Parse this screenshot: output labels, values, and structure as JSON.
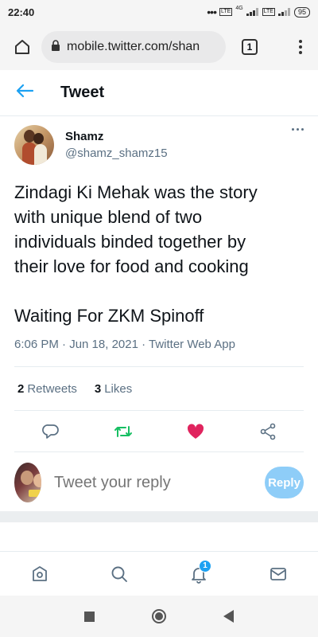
{
  "status_bar": {
    "time": "22:40",
    "network_label": "4G",
    "lte_label": "LTE",
    "battery": "95"
  },
  "browser": {
    "url": "mobile.twitter.com/shan",
    "tab_count": "1"
  },
  "page": {
    "title": "Tweet"
  },
  "tweet": {
    "display_name": "Shamz",
    "handle": "@shamz_shamz15",
    "text_lines": [
      "Zindagi Ki Mehak was the story",
      "with unique blend of two",
      "individuals binded together by",
      "their love for food and cooking"
    ],
    "text_line2": "Waiting For ZKM Spinoff",
    "timestamp": "6:06 PM · Jun 18, 2021 · Twitter Web App",
    "retweets_count": "2",
    "retweets_label": "Retweets",
    "likes_count": "3",
    "likes_label": "Likes",
    "like_color": "#e0245e",
    "retweet_color": "#17bf63"
  },
  "reply": {
    "placeholder": "Tweet your reply",
    "button_label": "Reply"
  },
  "bottom_nav": {
    "notifications_badge": "1",
    "accent": "#1da1f2"
  },
  "icons": [
    "back-arrow-icon",
    "home-icon",
    "lock-icon",
    "more-icon",
    "reply-icon",
    "retweet-icon",
    "heart-icon",
    "share-icon",
    "explore-icon",
    "search-icon",
    "notifications-icon",
    "messages-icon"
  ]
}
